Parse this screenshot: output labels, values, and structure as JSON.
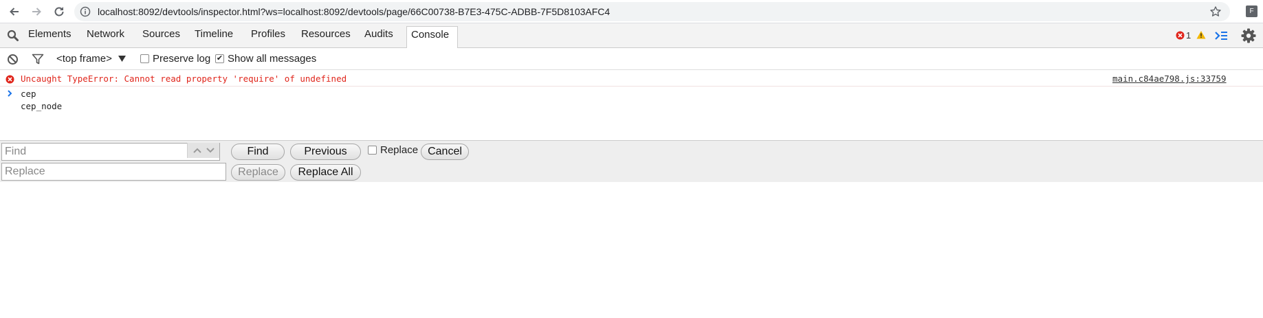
{
  "browser": {
    "url": "localhost:8092/devtools/inspector.html?ws=localhost:8092/devtools/page/66C00738-B7E3-475C-ADBB-7F5D8103AFC4",
    "profile_initial": "F"
  },
  "devtools": {
    "tabs": [
      {
        "label": "Elements"
      },
      {
        "label": "Network"
      },
      {
        "label": "Sources"
      },
      {
        "label": "Timeline"
      },
      {
        "label": "Profiles"
      },
      {
        "label": "Resources"
      },
      {
        "label": "Audits"
      },
      {
        "label": "Console",
        "active": true
      }
    ],
    "error_count": "1"
  },
  "console_toolbar": {
    "frame_selector": "<top frame>",
    "preserve_log_label": "Preserve log",
    "preserve_log_checked": false,
    "show_all_label": "Show all messages",
    "show_all_checked": true
  },
  "console": {
    "error_message": "Uncaught TypeError: Cannot read property 'require' of undefined",
    "error_source": "main.c84ae798.js:33759",
    "lines": [
      "cep",
      "cep_node"
    ]
  },
  "find_bar": {
    "find_placeholder": "Find",
    "replace_placeholder": "Replace",
    "find_button": "Find",
    "previous_button": "Previous",
    "replace_checkbox_label": "Replace",
    "cancel_button": "Cancel",
    "replace_button": "Replace",
    "replace_all_button": "Replace All"
  },
  "colors": {
    "error": "#e0251b",
    "accent": "#1a73e8",
    "warning": "#f2b600"
  }
}
